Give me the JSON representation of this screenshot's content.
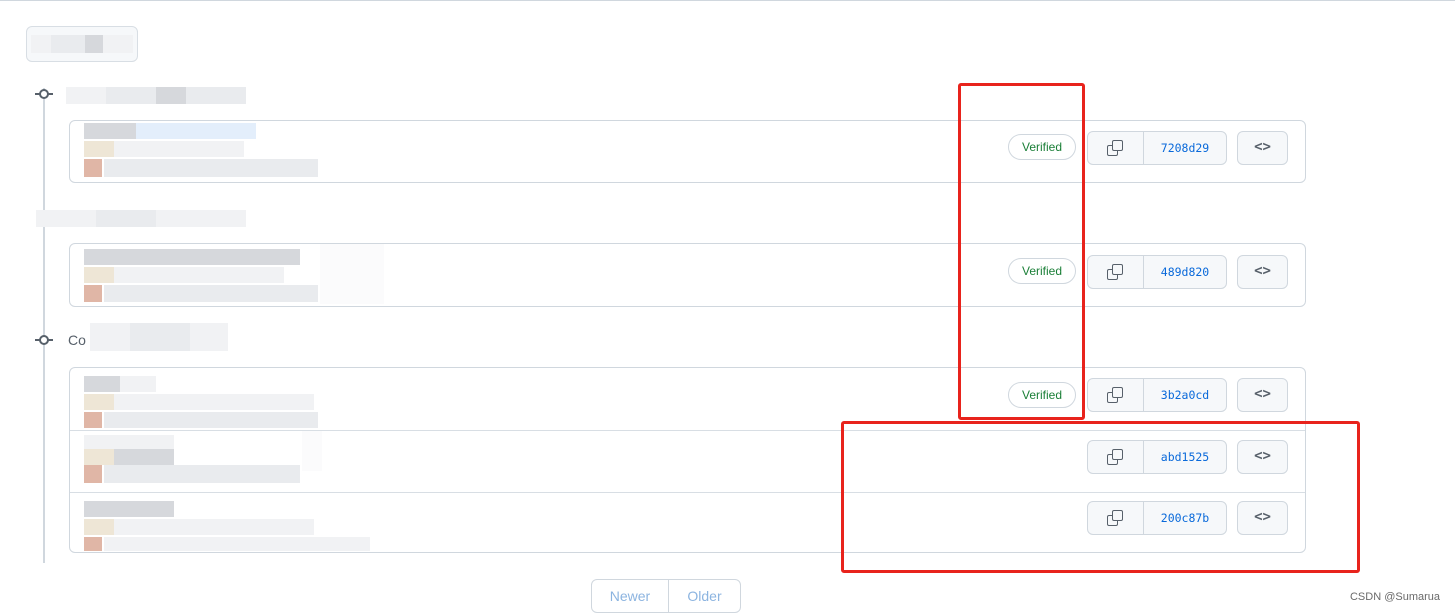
{
  "commit_groups": [
    {
      "commits": [
        {
          "verified_label": "Verified",
          "sha": "7208d29",
          "browse_label": "<>"
        }
      ]
    },
    {
      "commits": [
        {
          "verified_label": "Verified",
          "sha": "489d820",
          "browse_label": "<>"
        }
      ]
    },
    {
      "heading_visible_prefix": "Co",
      "commits": [
        {
          "verified_label": "Verified",
          "sha": "3b2a0cd",
          "browse_label": "<>"
        },
        {
          "sha": "abd1525",
          "browse_label": "<>"
        },
        {
          "sha": "200c87b",
          "browse_label": "<>"
        }
      ]
    }
  ],
  "pagination": {
    "newer_label": "Newer",
    "older_label": "Older"
  },
  "watermark": "CSDN @Sumarua",
  "colors": {
    "verified_green": "#1a7f37",
    "sha_link_blue": "#0969da",
    "annotation_red": "#e8231c",
    "border_gray": "#d0d7de"
  },
  "icons": [
    "copy-icon",
    "code-icon",
    "commit-node-icon"
  ]
}
